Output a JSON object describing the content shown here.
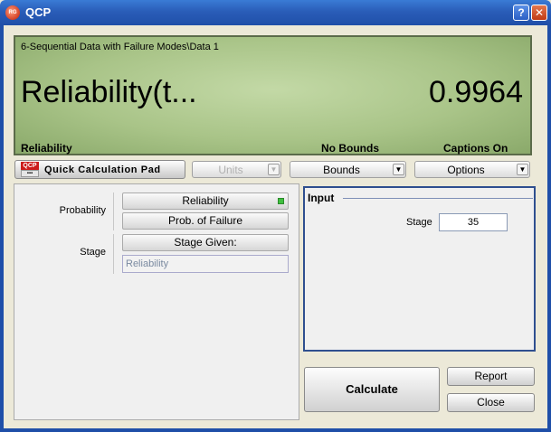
{
  "window": {
    "title": "QCP",
    "icon_text": "RG",
    "help_glyph": "?",
    "close_glyph": "✕"
  },
  "display": {
    "path": "6-Sequential Data with Failure Modes\\Data 1",
    "metric": "Reliability(t...",
    "value": "0.9964",
    "status": {
      "metric": "Reliability",
      "bounds": "No Bounds",
      "captions": "Captions On"
    }
  },
  "toolbar": {
    "qcp_logo_top": "QCP",
    "qcp_logo_bottom": "▪▪▪",
    "qcp_label": "Quick Calculation Pad",
    "units_label": "Units",
    "bounds_label": "Bounds",
    "options_label": "Options",
    "dropdown_arrow": "▼"
  },
  "left_panel": {
    "probability_label": "Probability",
    "reliability_button": "Reliability",
    "prob_failure_button": "Prob. of Failure",
    "stage_label": "Stage",
    "stage_given_button": "Stage Given:",
    "stage_field_value": "Reliability"
  },
  "input_panel": {
    "title": "Input",
    "stage_label": "Stage",
    "stage_value": "35"
  },
  "buttons": {
    "calculate": "Calculate",
    "report": "Report",
    "close": "Close"
  },
  "colors": {
    "lcd_green": "#a9c488",
    "titlebar_blue": "#2a5db8",
    "input_border": "#2f4f8f",
    "indicator_green": "#3fbf3f"
  }
}
